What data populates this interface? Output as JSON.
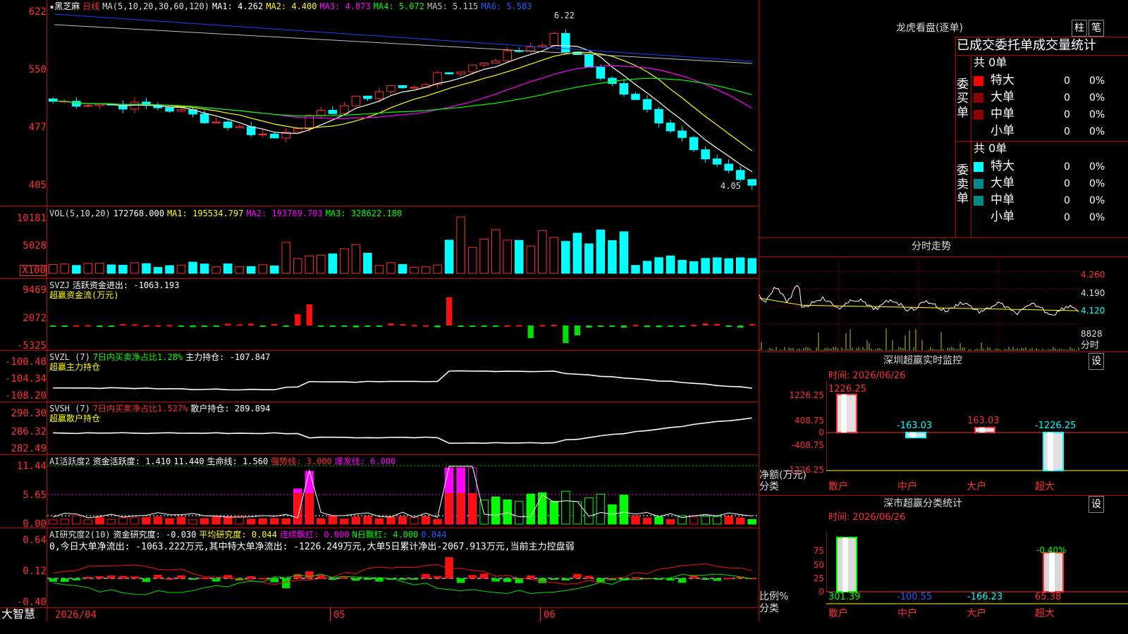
{
  "app": {
    "brand": "大智慧"
  },
  "stock": {
    "name": "黑芝麻",
    "period": "日线",
    "marker": "★"
  },
  "kline": {
    "ma_label": "MA(5,10,20,30,60,120)",
    "ma1": "MA1: 4.262",
    "ma2": "MA2: 4.400",
    "ma3": "MA3: 4.873",
    "ma4": "MA4: 5.072",
    "ma5": "MA5: 5.115",
    "ma6": "MA6: 5.583",
    "y_ticks": [
      "622",
      "550",
      "477",
      "405"
    ],
    "high_label": "6.22",
    "low_label": "4.05"
  },
  "volume": {
    "label": "VOL(5,10,20)",
    "value": "172768.000",
    "ma1": "MA1: 195534.797",
    "ma2": "MA2: 193789.703",
    "ma3": "MA3: 328622.188",
    "y_ticks": [
      "10181",
      "5028",
      "X100"
    ]
  },
  "svzj": {
    "label": "SVZJ",
    "title": "活跃资金进出: -1063.193",
    "subtitle": "超赢资金流(万元)",
    "y_ticks": [
      "9469",
      "2072",
      "-5325"
    ]
  },
  "svzl": {
    "label": "SVZL (7)",
    "ratio": "7日内买卖净占比1.28%",
    "hold": "主力持仓: -107.847",
    "subtitle": "超赢主力持仓",
    "y_ticks": [
      "-100.48",
      "-104.34",
      "-108.20"
    ]
  },
  "svsh": {
    "label": "SVSH (7)",
    "ratio": "7日内买卖净占比1.527%",
    "hold": "散户持仓: 289.894",
    "subtitle": "超赢散户持仓",
    "y_ticks": [
      "290.30",
      "286.32",
      "282.49"
    ]
  },
  "ai_active": {
    "label": "AI活跃度2",
    "activity": "资金活跃度: 1.410",
    "v2": "11.440",
    "life": "生命线: 1.560",
    "strong": "强势线: 3.000",
    "burst": "爆发线: 6.000",
    "y_ticks": [
      "11.44",
      "5.65",
      "0.00"
    ]
  },
  "ai_research": {
    "label": "AI研究度2(10)",
    "research": "资金研究度: -0.030",
    "avg": "平均研究度: 0.044",
    "streak": "连续飘红: 0.000",
    "nday": "N日飘红: 4.000",
    "extra": "0.044",
    "summary": "0,今日大单净流出: -1063.222万元,其中特大单净流出: -1226.249万元,大单5日累计净出-2067.913万元,当前主力控盘弱",
    "y_ticks": [
      "0.64",
      "0.12",
      "-0.40"
    ]
  },
  "dates": [
    "2026/04",
    "05",
    "06"
  ],
  "dragon": {
    "title": "龙虎看盘(逐单)",
    "btn1": "柱",
    "btn2": "笔",
    "header": "已成交委托单成交量统计",
    "buy": {
      "side": "委买单",
      "total": "共 0单",
      "rows": [
        {
          "label": "特大",
          "v": "0",
          "p": "0%"
        },
        {
          "label": "大单",
          "v": "0",
          "p": "0%"
        },
        {
          "label": "中单",
          "v": "0",
          "p": "0%"
        },
        {
          "label": "小单",
          "v": "0",
          "p": "0%"
        }
      ]
    },
    "sell": {
      "side": "委卖单",
      "total": "共 0单",
      "rows": [
        {
          "label": "特大",
          "v": "0",
          "p": "0%"
        },
        {
          "label": "大单",
          "v": "0",
          "p": "0%"
        },
        {
          "label": "中单",
          "v": "0",
          "p": "0%"
        },
        {
          "label": "小单",
          "v": "0",
          "p": "0%"
        }
      ]
    }
  },
  "intraday": {
    "title": "分时走势",
    "y_ticks": [
      "4.260",
      "4.190",
      "4.120"
    ],
    "vol_max": "8828",
    "vol_unit": "分时"
  },
  "monitor": {
    "title": "深圳超赢实时监控",
    "set": "设",
    "time": "时间: 2026/06/26",
    "unit": "净额(万元)",
    "cat": "分类",
    "y_ticks": [
      "1226.25",
      "408.75",
      "0",
      "-408.75",
      "-1226.25"
    ],
    "categories": [
      "散户",
      "中户",
      "大户",
      "超大"
    ],
    "values": [
      1226.25,
      -163.03,
      163.03,
      -1226.25
    ],
    "labels": [
      "1226.25",
      "-163.03",
      "163.03",
      "-1226.25"
    ]
  },
  "stats": {
    "title": "深市超赢分类统计",
    "set": "设",
    "time": "时间: 2026/06/26",
    "unit": "比例%",
    "cat": "分类",
    "y_ticks": [
      "75",
      "50",
      "25",
      "0"
    ],
    "categories": [
      "散户",
      "中户",
      "大户",
      "超大"
    ],
    "pct": [
      100,
      0,
      0,
      72
    ],
    "top_label": "-0.40%",
    "labels": [
      "301.39",
      "-100.55",
      "-166.23",
      "65.38"
    ]
  }
}
